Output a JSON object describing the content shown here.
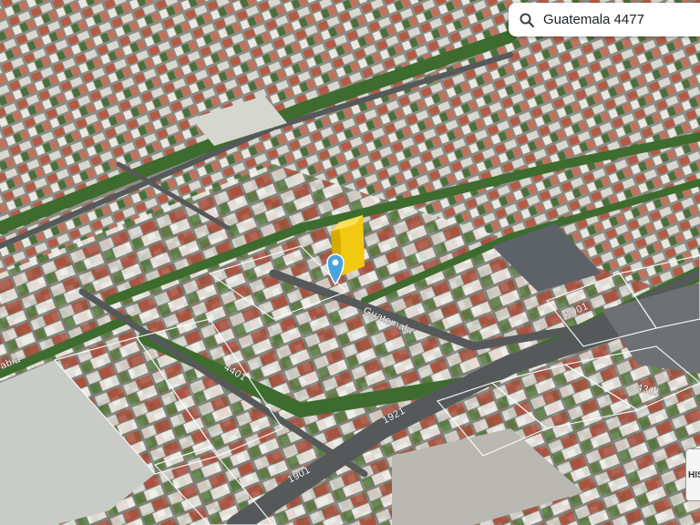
{
  "search": {
    "query": "Guatemala 4477"
  },
  "map": {
    "street_labels": {
      "guatemala": "Guatemala",
      "n4401": "4401",
      "n4301": "4301",
      "n1901": "1901",
      "n1921": "1921",
      "n1001": "1001",
      "gabia": "abia"
    }
  },
  "controls": {
    "history_button": "HIS"
  },
  "colors": {
    "marker": "#4aa3df",
    "building": "#f2c811",
    "vegetation": "#3e6b2e"
  }
}
